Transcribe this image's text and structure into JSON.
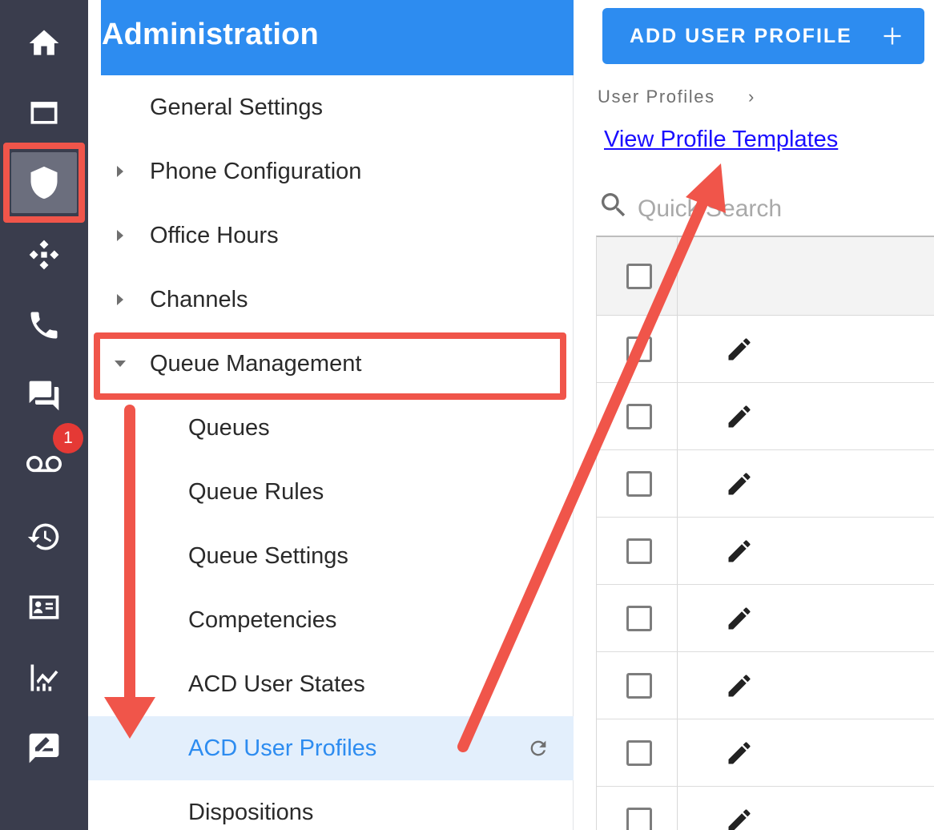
{
  "rail": {
    "items": [
      {
        "icon": "home-icon"
      },
      {
        "icon": "folder-icon"
      },
      {
        "icon": "shield-icon",
        "active": true
      },
      {
        "icon": "hub-icon"
      },
      {
        "icon": "phone-icon"
      },
      {
        "icon": "chat-icon"
      },
      {
        "icon": "voicemail-icon"
      },
      {
        "icon": "history-icon"
      },
      {
        "icon": "contact-card-icon"
      },
      {
        "icon": "analytics-icon"
      },
      {
        "icon": "feedback-icon"
      }
    ],
    "voicemail_badge": "1"
  },
  "nav": {
    "title": "Administration",
    "items": [
      {
        "label": "General Settings"
      },
      {
        "label": "Phone Configuration"
      },
      {
        "label": "Office Hours"
      },
      {
        "label": "Channels"
      },
      {
        "label": "Queue Management"
      }
    ],
    "subitems": [
      {
        "label": "Queues"
      },
      {
        "label": "Queue Rules"
      },
      {
        "label": "Queue Settings"
      },
      {
        "label": "Competencies"
      },
      {
        "label": "ACD User States"
      },
      {
        "label": "ACD User Profiles",
        "active": true
      },
      {
        "label": "Dispositions"
      }
    ]
  },
  "main": {
    "add_button": "ADD USER PROFILE",
    "breadcrumb": "User Profiles",
    "breadcrumb_separator": "›",
    "templates_link": "View Profile Templates",
    "search_placeholder": "Quick Search"
  },
  "colors": {
    "brand_blue": "#2d8cf0",
    "rail_bg": "#3a3d4d",
    "annotation_red": "#f0554a",
    "badge_red": "#e53935"
  }
}
